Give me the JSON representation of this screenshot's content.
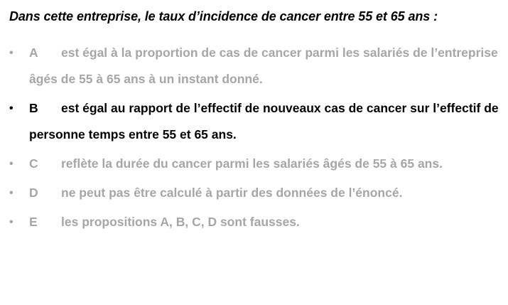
{
  "question": "Dans cette entreprise, le taux d’incidence de cancer entre 55 et 65 ans :",
  "bullet": "•",
  "options": [
    {
      "letter": "A",
      "text": "est égal à la proportion de cas de cancer parmi les salariés de l’entreprise âgés de 55 à 65 ans à un instant donné.",
      "highlighted": false
    },
    {
      "letter": "B",
      "text": "est égal au rapport de l’effectif de nouveaux cas de cancer sur l’effectif de personne temps entre 55 et 65 ans.",
      "highlighted": true
    },
    {
      "letter": "C",
      "text": "reflète la durée du cancer parmi les salariés âgés de 55 à 65 ans.",
      "highlighted": false
    },
    {
      "letter": "D",
      "text": "ne peut pas être calculé à partir des données de l’énoncé.",
      "highlighted": false
    },
    {
      "letter": "E",
      "text": "les propositions A, B, C, D sont fausses.",
      "highlighted": false
    }
  ],
  "colors": {
    "highlighted_text": "#000000",
    "dimmed_text": "#a6a6a6",
    "background": "#ffffff"
  }
}
